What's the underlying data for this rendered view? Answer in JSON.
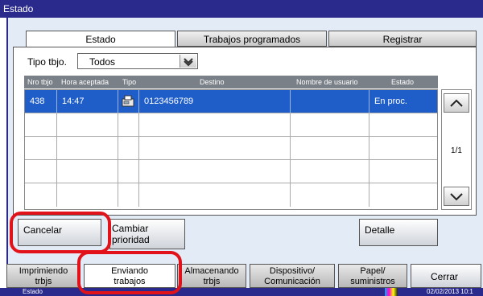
{
  "window": {
    "title": "Estado"
  },
  "tabs": [
    {
      "label": "Estado"
    },
    {
      "label": "Trabajos programados"
    },
    {
      "label": "Registrar"
    }
  ],
  "filter": {
    "label": "Tipo tbjo.",
    "value": "Todos"
  },
  "table": {
    "headers": [
      "Nro tbjo",
      "Hora aceptada",
      "Tipo",
      "Destino",
      "Nombre de usuario",
      "Estado"
    ],
    "rows": [
      {
        "job": "438",
        "time": "14:47",
        "type_icon": "fax-icon",
        "destination": "0123456789",
        "user": "",
        "status": "En proc."
      }
    ]
  },
  "pagination": {
    "current": "1/1"
  },
  "buttons": {
    "cancel": "Cancelar",
    "priority_line1": "Cambiar",
    "priority_line2": "prioridad",
    "detail": "Detalle",
    "close": "Cerrar"
  },
  "bottom_tabs": [
    {
      "line1": "Imprimiendo",
      "line2": "trbjs"
    },
    {
      "line1": "Enviando",
      "line2": "trabajos"
    },
    {
      "line1": "Almacenando",
      "line2": "trbjs"
    },
    {
      "line1": "Dispositivo/",
      "line2": "Comunicación"
    },
    {
      "line1": "Papel/",
      "line2": "suministros"
    }
  ],
  "status_bar": {
    "left": "Estado",
    "datetime": "02/02/2013 10:1"
  },
  "colors": {
    "accent": "#2a2a8c",
    "selection": "#1f5ec9",
    "highlight_ring": "#e2121a"
  }
}
